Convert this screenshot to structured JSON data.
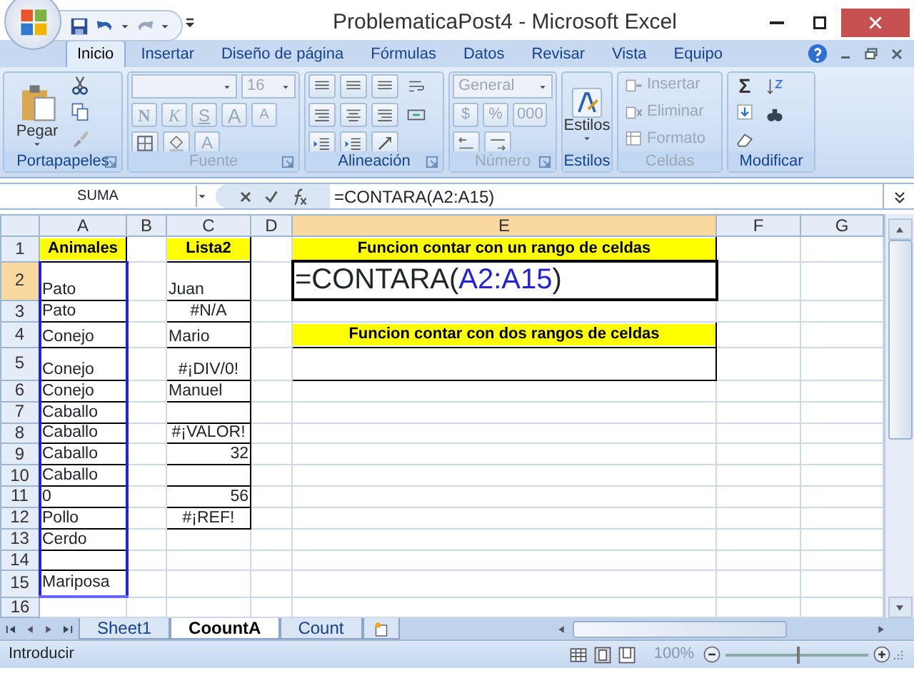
{
  "window": {
    "title": "ProblematicaPost4 - Microsoft Excel"
  },
  "ribbon_tabs": [
    {
      "label": "Inicio",
      "selected": true
    },
    {
      "label": "Insertar",
      "selected": false
    },
    {
      "label": "Diseño de página",
      "selected": false
    },
    {
      "label": "Fórmulas",
      "selected": false
    },
    {
      "label": "Datos",
      "selected": false
    },
    {
      "label": "Revisar",
      "selected": false
    },
    {
      "label": "Vista",
      "selected": false
    },
    {
      "label": "Equipo",
      "selected": false
    }
  ],
  "ribbon": {
    "clipboard": {
      "label": "Portapapeles",
      "paste": "Pegar"
    },
    "font": {
      "label": "Fuente",
      "disabled": true,
      "size": "16",
      "bold": "N",
      "italic": "K",
      "underline": "S",
      "grow": "A",
      "shrink": "A",
      "font_color": "A"
    },
    "alignment": {
      "label": "Alineación"
    },
    "number": {
      "label": "Número",
      "disabled": true,
      "format": "General",
      "currency": "$",
      "percent": "%",
      "thousands": "000"
    },
    "styles": {
      "label": "Estilos",
      "button": "Estilos"
    },
    "cells": {
      "label": "Celdas",
      "disabled": true,
      "insert": "Insertar",
      "delete": "Eliminar",
      "format": "Formato"
    },
    "editing": {
      "label": "Modificar",
      "sum": "Σ"
    }
  },
  "formula_bar": {
    "name_box": "SUMA",
    "formula": "=CONTARA(A2:A15)"
  },
  "grid": {
    "columns": [
      {
        "label": "A",
        "selected": false
      },
      {
        "label": "B",
        "selected": false
      },
      {
        "label": "C",
        "selected": false
      },
      {
        "label": "D",
        "selected": false
      },
      {
        "label": "E",
        "selected": true
      },
      {
        "label": "F",
        "selected": false
      },
      {
        "label": "G",
        "selected": false
      }
    ],
    "rows": [
      {
        "header": "1",
        "selected": false,
        "cells": [
          {
            "text": "Animales",
            "kind": "heading"
          },
          "",
          {
            "text": "Lista2",
            "kind": "heading"
          },
          "",
          {
            "text": "Funcion contar con un rango de celdas",
            "kind": "heading"
          },
          "",
          ""
        ]
      },
      {
        "header": "2",
        "selected": true,
        "cells": [
          {
            "text": "Pato",
            "kind": "text"
          },
          "",
          {
            "text": "Juan",
            "kind": "text"
          },
          "",
          {
            "kind": "formula",
            "segments": [
              {
                "text": "=CONTARA(",
                "kind": "plain"
              },
              {
                "text": "A2:A15",
                "kind": "reference"
              },
              {
                "text": ")",
                "kind": "plain"
              }
            ]
          },
          "",
          ""
        ]
      },
      {
        "header": "3",
        "selected": false,
        "cells": [
          {
            "text": "Pato",
            "kind": "text"
          },
          "",
          {
            "text": "#N/A",
            "kind": "error"
          },
          "",
          "",
          "",
          ""
        ]
      },
      {
        "header": "4",
        "selected": false,
        "cells": [
          {
            "text": "Conejo",
            "kind": "text"
          },
          "",
          {
            "text": "Mario",
            "kind": "text"
          },
          "",
          {
            "text": "Funcion contar con dos rangos de celdas",
            "kind": "heading"
          },
          "",
          ""
        ]
      },
      {
        "header": "5",
        "selected": false,
        "cells": [
          {
            "text": "Conejo",
            "kind": "text"
          },
          "",
          {
            "text": "#¡DIV/0!",
            "kind": "error"
          },
          "",
          "",
          "",
          ""
        ]
      },
      {
        "header": "6",
        "selected": false,
        "cells": [
          {
            "text": "Conejo",
            "kind": "text"
          },
          "",
          {
            "text": "Manuel",
            "kind": "text"
          },
          "",
          "",
          "",
          ""
        ]
      },
      {
        "header": "7",
        "selected": false,
        "cells": [
          {
            "text": "Caballo",
            "kind": "text"
          },
          "",
          "",
          "",
          "",
          "",
          ""
        ]
      },
      {
        "header": "8",
        "selected": false,
        "cells": [
          {
            "text": "Caballo",
            "kind": "text"
          },
          "",
          {
            "text": "#¡VALOR!",
            "kind": "error"
          },
          "",
          "",
          "",
          ""
        ]
      },
      {
        "header": "9",
        "selected": false,
        "cells": [
          {
            "text": "Caballo",
            "kind": "text"
          },
          "",
          {
            "text": "32",
            "kind": "number"
          },
          "",
          "",
          "",
          ""
        ]
      },
      {
        "header": "10",
        "selected": false,
        "cells": [
          {
            "text": "Caballo",
            "kind": "text"
          },
          "",
          "",
          "",
          "",
          "",
          ""
        ]
      },
      {
        "header": "11",
        "selected": false,
        "cells": [
          {
            "text": "0",
            "kind": "text"
          },
          "",
          {
            "text": "56",
            "kind": "number"
          },
          "",
          "",
          "",
          ""
        ]
      },
      {
        "header": "12",
        "selected": false,
        "cells": [
          {
            "text": "Pollo",
            "kind": "text"
          },
          "",
          {
            "text": "#¡REF!",
            "kind": "error"
          },
          "",
          "",
          "",
          ""
        ]
      },
      {
        "header": "13",
        "selected": false,
        "cells": [
          {
            "text": "Cerdo",
            "kind": "text"
          },
          "",
          "",
          "",
          "",
          "",
          ""
        ]
      },
      {
        "header": "14",
        "selected": false,
        "cells": [
          "",
          "",
          "",
          "",
          "",
          "",
          ""
        ]
      },
      {
        "header": "15",
        "selected": false,
        "cells": [
          {
            "text": "Mariposa",
            "kind": "text"
          },
          "",
          "",
          "",
          "",
          "",
          ""
        ]
      },
      {
        "header": "16",
        "selected": false,
        "cells": [
          "",
          "",
          "",
          "",
          "",
          "",
          ""
        ]
      }
    ]
  },
  "sheet_tabs": [
    {
      "label": "Sheet1",
      "selected": false
    },
    {
      "label": "CoountA",
      "selected": true
    },
    {
      "label": "Count",
      "selected": false
    }
  ],
  "status_bar": {
    "mode": "Introducir",
    "zoom": "100%",
    "zoom_slider": {
      "level": 0.5
    }
  }
}
